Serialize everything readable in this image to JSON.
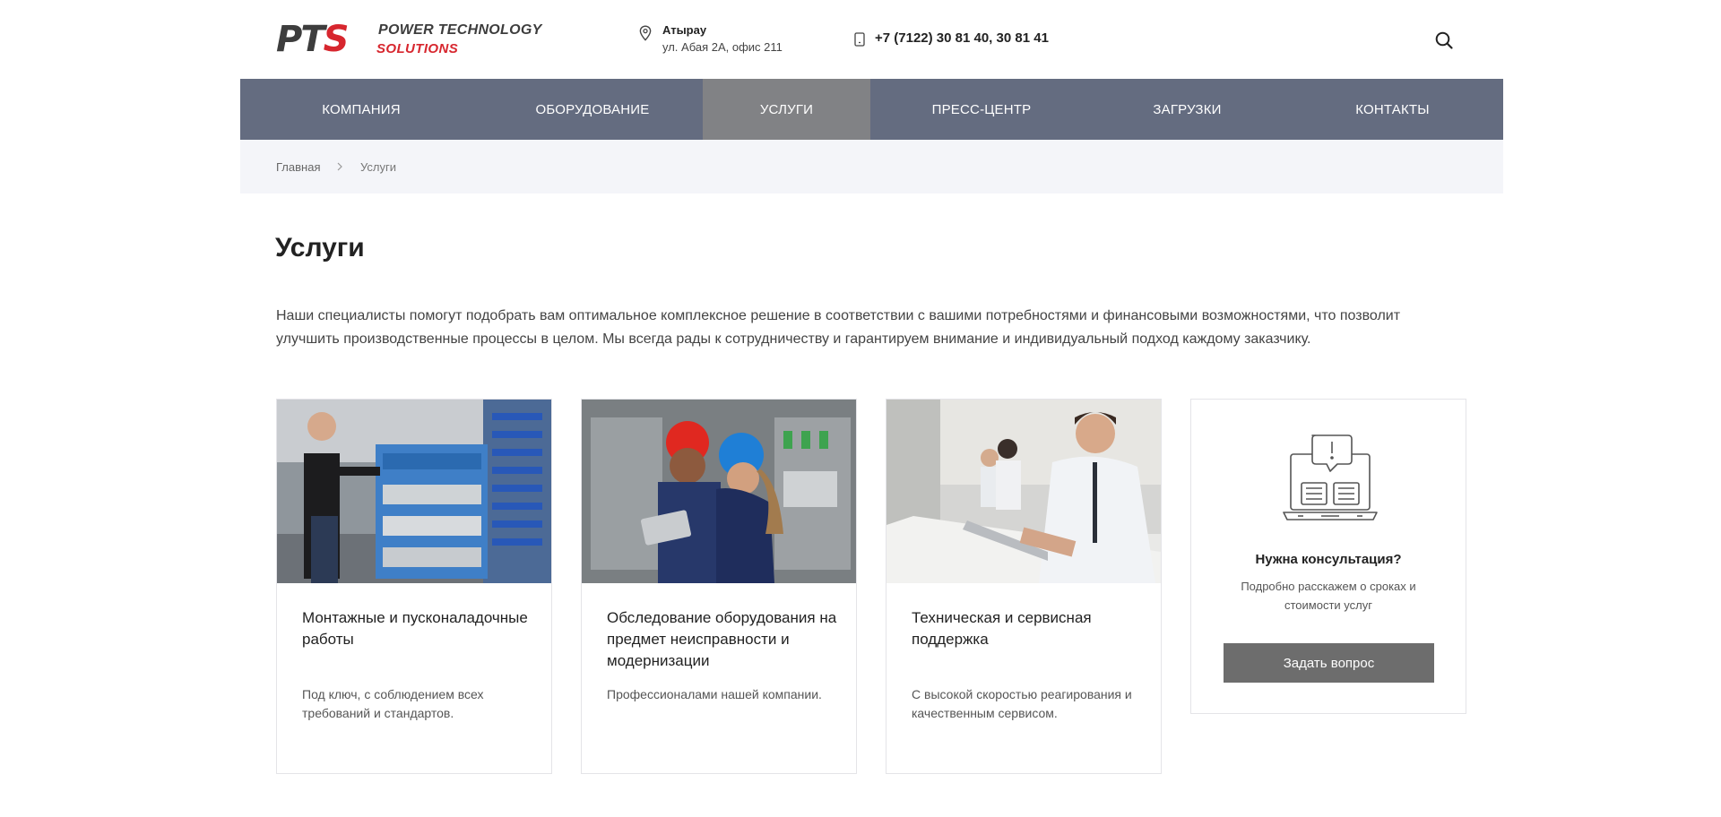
{
  "header": {
    "logo": {
      "mark_pt": "PT",
      "mark_s": "S",
      "line1": "POWER TECHNOLOGY",
      "line2": "SOLUTIONS"
    },
    "address": {
      "city": "Атырау",
      "street": "ул. Абая 2А, офис 211",
      "icon": "map-pin-icon"
    },
    "phone": {
      "text": "+7 (7122) 30 81 40, 30 81 41",
      "icon": "phone-icon"
    },
    "search_icon": "search-icon"
  },
  "nav": {
    "items": [
      {
        "label": "КОМПАНИЯ",
        "active": false
      },
      {
        "label": "ОБОРУДОВАНИЕ",
        "active": false
      },
      {
        "label": "УСЛУГИ",
        "active": true
      },
      {
        "label": "ПРЕСС-ЦЕНТР",
        "active": false
      },
      {
        "label": "ЗАГРУЗКИ",
        "active": false
      },
      {
        "label": "КОНТАКТЫ",
        "active": false
      }
    ]
  },
  "breadcrumb": {
    "home": "Главная",
    "current": "Услуги"
  },
  "page": {
    "title": "Услуги",
    "intro": "Наши специалисты помогут подобрать вам оптимальное комплексное решение в соответствии с вашими потребностями и финансовыми возможностями, что позволит улучшить производственные процессы в целом. Мы всегда рады к сотрудничеству и гарантируем внимание и индивидуальный подход каждому заказчику."
  },
  "cards": [
    {
      "title": "Монтажные и пусконаладочные работы",
      "desc": "Под ключ, с соблюдением всех требований и стандартов."
    },
    {
      "title": "Обследование оборудования на предмет неисправности и модернизации",
      "desc": "Профессионалами нашей компании."
    },
    {
      "title": "Техническая и сервисная поддержка",
      "desc": "С высокой скоростью реагирования и качественным сервисом."
    }
  ],
  "consult": {
    "title": "Нужна консультация?",
    "desc": "Подробно расскажем о сроках и стоимости услуг",
    "button": "Задать вопрос",
    "icon": "laptop-chat-icon"
  },
  "colors": {
    "nav_bg": "#646c80",
    "nav_active": "#818285",
    "brand_red": "#d7262e",
    "button": "#6d6d6d"
  }
}
